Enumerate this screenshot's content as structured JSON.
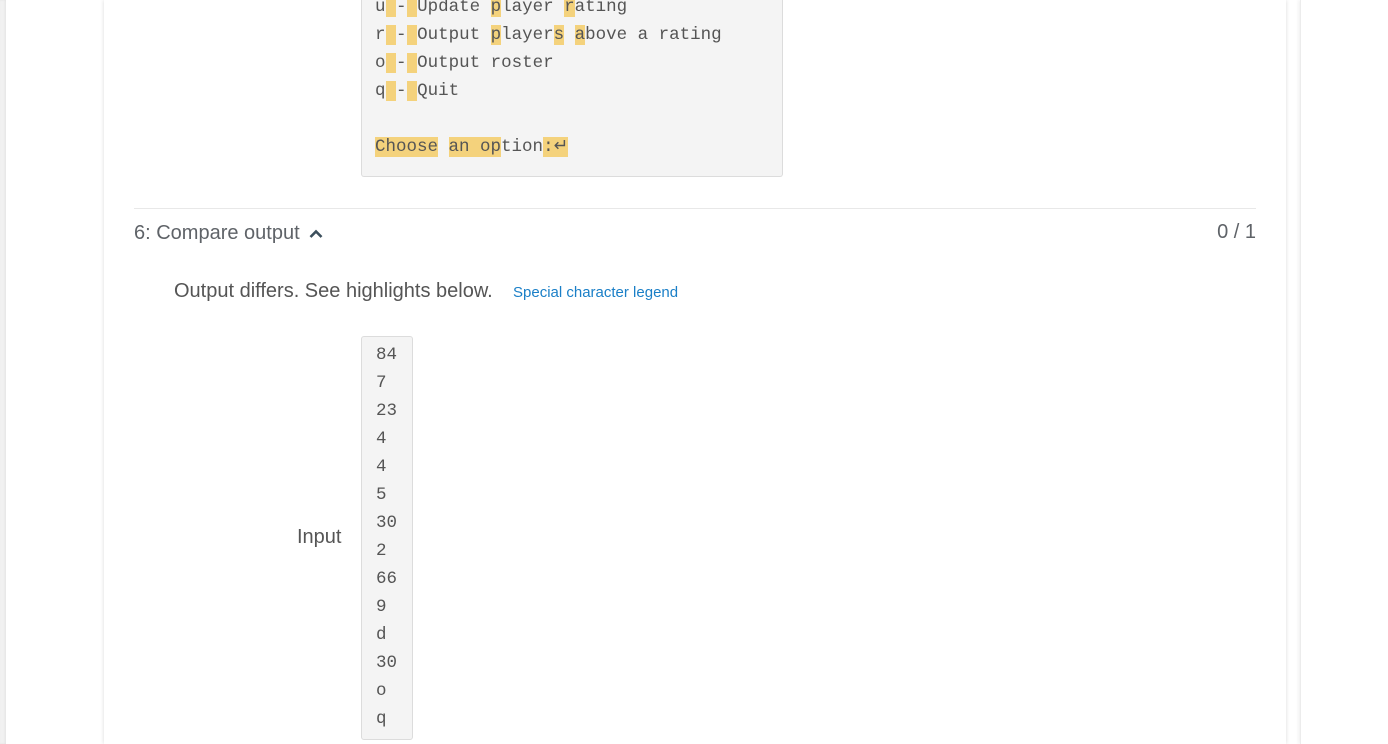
{
  "expected_output_tail": {
    "lines": [
      {
        "segments": [
          {
            "t": "u",
            "h": false
          },
          {
            "t": " ",
            "h": true
          },
          {
            "t": "-",
            "h": false
          },
          {
            "t": " ",
            "h": true
          },
          {
            "t": "Update ",
            "h": false
          },
          {
            "t": "p",
            "h": true
          },
          {
            "t": "layer ",
            "h": false
          },
          {
            "t": "r",
            "h": true
          },
          {
            "t": "ating",
            "h": false
          }
        ]
      },
      {
        "segments": [
          {
            "t": "r",
            "h": false
          },
          {
            "t": " ",
            "h": true
          },
          {
            "t": "-",
            "h": false
          },
          {
            "t": " ",
            "h": true
          },
          {
            "t": "Output ",
            "h": false
          },
          {
            "t": "p",
            "h": true
          },
          {
            "t": "layer",
            "h": false
          },
          {
            "t": "s",
            "h": true
          },
          {
            "t": " ",
            "h": false
          },
          {
            "t": "a",
            "h": true
          },
          {
            "t": "bove a rating",
            "h": false
          }
        ]
      },
      {
        "segments": [
          {
            "t": "o",
            "h": false
          },
          {
            "t": " ",
            "h": true
          },
          {
            "t": "-",
            "h": false
          },
          {
            "t": " ",
            "h": true
          },
          {
            "t": "Output roster",
            "h": false
          }
        ]
      },
      {
        "segments": [
          {
            "t": "q",
            "h": false
          },
          {
            "t": " ",
            "h": true
          },
          {
            "t": "-",
            "h": false
          },
          {
            "t": " ",
            "h": true
          },
          {
            "t": "Quit",
            "h": false
          }
        ]
      },
      {
        "segments": []
      },
      {
        "segments": [
          {
            "t": "Choose",
            "h": true
          },
          {
            "t": " ",
            "h": false
          },
          {
            "t": "an op",
            "h": true
          },
          {
            "t": "tion",
            "h": false
          },
          {
            "t": ":↵",
            "h": true
          }
        ]
      }
    ]
  },
  "test": {
    "title": "6: Compare output",
    "chevron_icon": "chevron-up-icon",
    "score": "0 / 1",
    "status_message": "Output differs. See highlights below.",
    "legend_link": "Special character legend",
    "input_label": "Input",
    "input_lines": [
      "84",
      "7",
      "23",
      "4",
      "4",
      "5",
      "30",
      "2",
      "66",
      "9",
      "d",
      "30",
      "o",
      "q"
    ]
  },
  "colors": {
    "highlight": "#f4d27c",
    "link": "#1a7fc7"
  }
}
